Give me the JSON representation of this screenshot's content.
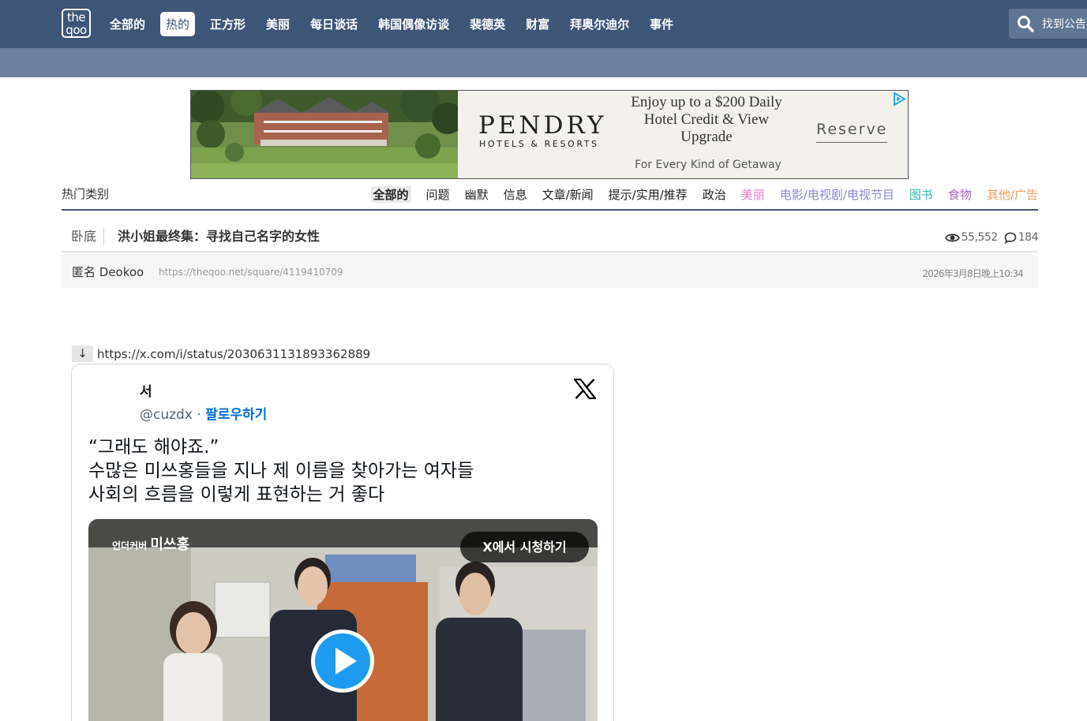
{
  "nav": {
    "logo_top": "the",
    "logo_bottom": "qoo",
    "items": [
      "全部的",
      "热的",
      "正方形",
      "美丽",
      "每日谈话",
      "韩国偶像访谈",
      "裴德英",
      "财富",
      "拜奥尔迪尔",
      "事件"
    ],
    "active_index": 1,
    "search_placeholder": "找到公告"
  },
  "ad": {
    "brand": "PENDRY",
    "sub": "HOTELS & RESORTS",
    "headline": "Enjoy up to a $200 Daily Hotel Credit & View Upgrade",
    "cta": "Reserve",
    "tagline": "For Every Kind of Getaway"
  },
  "category": {
    "title": "热门类别",
    "items": [
      {
        "label": "全部的",
        "color": "#222222"
      },
      {
        "label": "问题",
        "color": "#222222"
      },
      {
        "label": "幽默",
        "color": "#222222"
      },
      {
        "label": "信息",
        "color": "#222222"
      },
      {
        "label": "文章/新闻",
        "color": "#222222"
      },
      {
        "label": "提示/实用/推荐",
        "color": "#222222"
      },
      {
        "label": "政治",
        "color": "#222222"
      },
      {
        "label": "美丽",
        "color": "#e879c9"
      },
      {
        "label": "电影/电视剧/电视节目",
        "color": "#8b86d6"
      },
      {
        "label": "图书",
        "color": "#3bb6b0"
      },
      {
        "label": "食物",
        "color": "#a96bc9"
      },
      {
        "label": "其他/广告",
        "color": "#f09a5a"
      }
    ]
  },
  "post": {
    "board": "卧底",
    "title": "洪小姐最终集：寻找自己名字的女性",
    "views": "55,552",
    "comments": "184",
    "author": "匿名 Deokoo",
    "url": "https://theqoo.net/square/4119410709",
    "date": "2026年3月8日晚上10:34",
    "link_arrow": "↓",
    "link": "https://x.com/i/status/2030631131893362889"
  },
  "tweet": {
    "name": "서",
    "handle": "@cuzdx · ",
    "follow": "팔로우하기",
    "lines": [
      "“그래도 해야죠.”",
      "수많은 미쓰홍들을 지나 제 이름을 찾아가는 여자들",
      "사회의 흐름을 이렇게 표현하는 거 좋다"
    ],
    "media_caption_small": "언더커버",
    "media_caption_big": "미쓰홍",
    "watch_label": "X에서 시청하기"
  }
}
